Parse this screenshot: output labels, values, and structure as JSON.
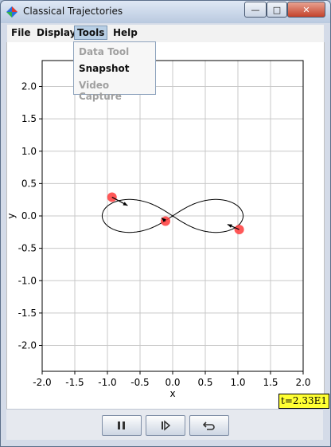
{
  "window": {
    "title": "Classical Trajectories",
    "controls": {
      "minimize": "—",
      "maximize": "□",
      "close": "✕"
    }
  },
  "menu": {
    "file": "File",
    "display": "Display",
    "tools": "Tools",
    "help": "Help"
  },
  "tools_menu": {
    "data_tool": "Data Tool",
    "snapshot": "Snapshot",
    "video_capture": "Video Capture"
  },
  "chart_data": {
    "type": "scatter",
    "xlabel": "x",
    "ylabel": "y",
    "xlim": [
      -2.0,
      2.0
    ],
    "ylim": [
      -2.4,
      2.4
    ],
    "xticks": [
      "-2.0",
      "-1.5",
      "-1.0",
      "-0.5",
      "0.0",
      "0.5",
      "1.0",
      "1.5",
      "2.0"
    ],
    "yticks": [
      "2.0",
      "1.5",
      "1.0",
      "0.5",
      "0.0",
      "-0.5",
      "-1.0",
      "-1.5",
      "-2.0"
    ],
    "grid": true,
    "trajectory": "figure-eight",
    "bodies": [
      {
        "x": -0.93,
        "y": 0.29,
        "vx": 0.24,
        "vy": -0.13
      },
      {
        "x": -0.11,
        "y": -0.08,
        "vx": -0.06,
        "vy": 0.05
      },
      {
        "x": 1.02,
        "y": -0.21,
        "vx": -0.18,
        "vy": 0.08
      }
    ],
    "colors": {
      "body": "#ff3b3b",
      "path": "#000000",
      "grid": "#c8c8c8"
    }
  },
  "time_readout": "t=2.33E1",
  "controls": {
    "pause_icon": "pause-icon",
    "step_icon": "step-icon",
    "reset_icon": "reset-icon"
  }
}
